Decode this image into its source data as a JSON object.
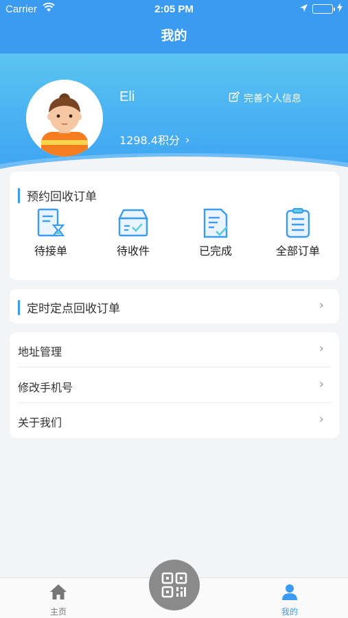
{
  "status_bar": {
    "carrier": "Carrier",
    "time": "2:05 PM"
  },
  "header": {
    "title": "我的"
  },
  "profile": {
    "name": "Eli",
    "points": "1298.4积分",
    "edit_label": "完善个人信息"
  },
  "orders": {
    "title": "预约回收订单",
    "items": [
      {
        "label": "待接单",
        "icon": "pending-order-icon"
      },
      {
        "label": "待收件",
        "icon": "to-collect-box-icon"
      },
      {
        "label": "已完成",
        "icon": "completed-doc-icon"
      },
      {
        "label": "全部订单",
        "icon": "all-orders-clipboard-icon"
      }
    ]
  },
  "scheduled": {
    "title": "定时定点回收订单"
  },
  "menu": {
    "items": [
      {
        "label": "地址管理"
      },
      {
        "label": "修改手机号"
      },
      {
        "label": "关于我们"
      }
    ]
  },
  "tabbar": {
    "home_label": "主页",
    "mine_label": "我的",
    "active": "mine"
  },
  "colors": {
    "primary": "#3a9bf1",
    "battery": "#7ee05a"
  }
}
